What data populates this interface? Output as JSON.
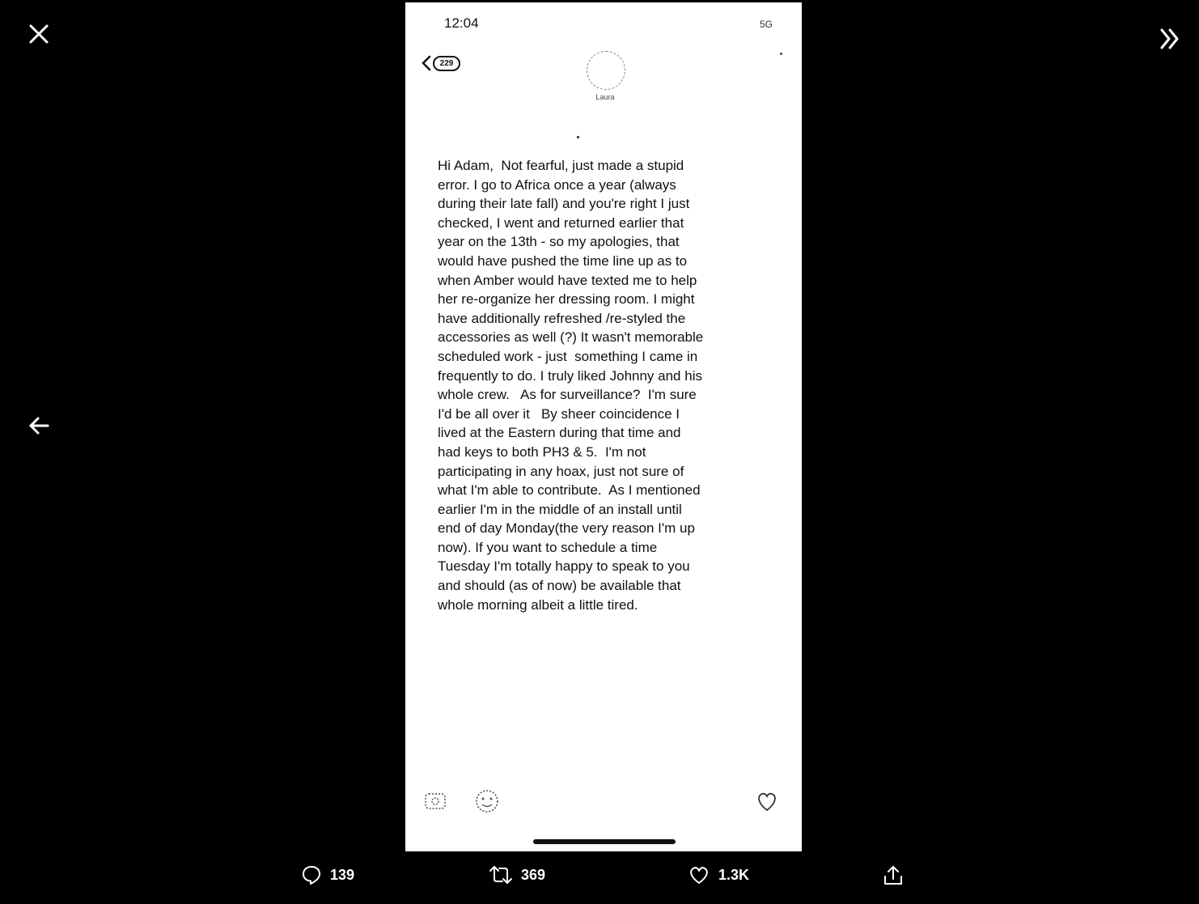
{
  "viewer": {
    "close_icon": "close-icon",
    "prev_icon": "arrow-left-icon",
    "expand_icon": "chevron-double-right-icon"
  },
  "phone": {
    "status_time": "12:04",
    "status_right": "5G",
    "badge_count": "229",
    "contact_name": "Laura",
    "message_text": "Hi Adam,  Not fearful, just made a stupid error. I go to Africa once a year (always during their late fall) and you're right I just checked, I went and returned earlier that year on the 13th - so my apologies, that would have pushed the time line up as to when Amber would have texted me to help her re-organize her dressing room. I might have additionally refreshed /re-styled the accessories as well (?) It wasn't memorable scheduled work - just  something I came in frequently to do. I truly liked Johnny and his whole crew.   As for surveillance?  I'm sure I'd be all over it   By sheer coincidence I lived at the Eastern during that time and had keys to both PH3 & 5.  I'm not participating in any hoax, just not sure of what I'm able to contribute.  As I mentioned earlier I'm in the middle of an install until end of day Monday(the very reason I'm up now). If you want to schedule a time Tuesday I'm totally happy to speak to you and should (as of now) be available that whole morning albeit a little tired."
  },
  "actions": {
    "replies": "139",
    "retweets": "369",
    "likes": "1.3K"
  },
  "colors": {
    "background": "#000000",
    "phone_background": "#ffffff",
    "text": "#111111"
  }
}
